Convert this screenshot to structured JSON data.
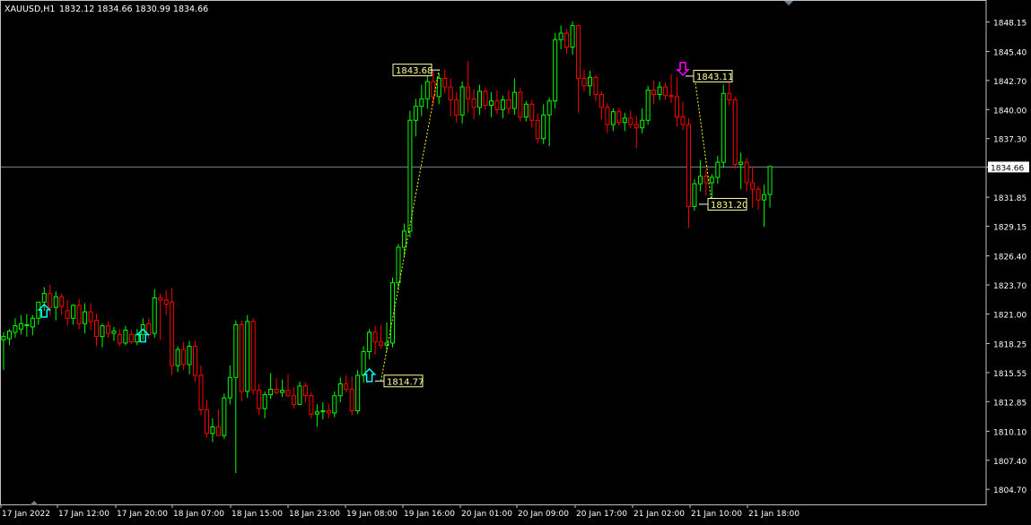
{
  "header": {
    "symbol_timeframe": "XAUUSD,H1",
    "ohlc": "1832.12 1834.66 1830.99 1834.66"
  },
  "colors": {
    "background": "#000000",
    "frame": "#c0c0c0",
    "bull": "#00ff00",
    "bear": "#ff0000",
    "text": "#ffffff",
    "bid_line": "#778899",
    "price_label_bg": "#ffff99",
    "buy_arrow": "#00ffff",
    "sell_arrow": "#ff00ff"
  },
  "chart_data": {
    "type": "candlestick",
    "symbol": "XAUUSD",
    "timeframe": "H1",
    "ylim": [
      1803.3,
      1850.1
    ],
    "y_ticks": [
      "1848.15",
      "1845.40",
      "1842.70",
      "1840.00",
      "1837.30",
      "1834.66",
      "1831.85",
      "1829.15",
      "1826.40",
      "1823.70",
      "1821.00",
      "1818.25",
      "1815.55",
      "1812.85",
      "1810.10",
      "1807.40",
      "1804.70"
    ],
    "x_ticks": [
      "17 Jan 2022",
      "17 Jan 12:00",
      "17 Jan 20:00",
      "18 Jan 07:00",
      "18 Jan 15:00",
      "18 Jan 23:00",
      "19 Jan 08:00",
      "19 Jan 16:00",
      "20 Jan 01:00",
      "20 Jan 09:00",
      "20 Jan 17:00",
      "21 Jan 02:00",
      "21 Jan 10:00",
      "21 Jan 18:00"
    ],
    "current_price": "1834.66",
    "candles": [
      {
        "o": 1818.6,
        "h": 1819.3,
        "l": 1815.8,
        "c": 1818.9
      },
      {
        "o": 1818.7,
        "h": 1819.6,
        "l": 1818.1,
        "c": 1819.4
      },
      {
        "o": 1819.3,
        "h": 1820.6,
        "l": 1818.8,
        "c": 1819.9
      },
      {
        "o": 1819.6,
        "h": 1820.9,
        "l": 1819.1,
        "c": 1820.1
      },
      {
        "o": 1820.0,
        "h": 1821.0,
        "l": 1818.9,
        "c": 1820.0
      },
      {
        "o": 1819.8,
        "h": 1820.9,
        "l": 1819.0,
        "c": 1820.6
      },
      {
        "o": 1820.6,
        "h": 1821.7,
        "l": 1820.0,
        "c": 1822.1
      },
      {
        "o": 1822.1,
        "h": 1823.5,
        "l": 1821.3,
        "c": 1822.9
      },
      {
        "o": 1822.9,
        "h": 1823.7,
        "l": 1820.9,
        "c": 1821.6
      },
      {
        "o": 1821.6,
        "h": 1823.1,
        "l": 1820.4,
        "c": 1822.6
      },
      {
        "o": 1822.6,
        "h": 1822.9,
        "l": 1820.9,
        "c": 1821.7
      },
      {
        "o": 1821.3,
        "h": 1822.3,
        "l": 1819.9,
        "c": 1820.6
      },
      {
        "o": 1820.6,
        "h": 1821.9,
        "l": 1820.0,
        "c": 1821.8
      },
      {
        "o": 1821.8,
        "h": 1822.4,
        "l": 1819.6,
        "c": 1820.1
      },
      {
        "o": 1820.1,
        "h": 1822.0,
        "l": 1819.2,
        "c": 1821.2
      },
      {
        "o": 1821.2,
        "h": 1822.0,
        "l": 1819.5,
        "c": 1820.3
      },
      {
        "o": 1820.4,
        "h": 1821.0,
        "l": 1818.0,
        "c": 1818.9
      },
      {
        "o": 1818.9,
        "h": 1820.1,
        "l": 1817.9,
        "c": 1819.9
      },
      {
        "o": 1819.9,
        "h": 1820.3,
        "l": 1818.8,
        "c": 1819.2
      },
      {
        "o": 1819.2,
        "h": 1819.8,
        "l": 1818.5,
        "c": 1819.4
      },
      {
        "o": 1819.1,
        "h": 1819.6,
        "l": 1818.0,
        "c": 1818.3
      },
      {
        "o": 1818.3,
        "h": 1819.9,
        "l": 1818.1,
        "c": 1819.5
      },
      {
        "o": 1819.1,
        "h": 1819.5,
        "l": 1818.2,
        "c": 1818.4
      },
      {
        "o": 1818.4,
        "h": 1819.6,
        "l": 1818.1,
        "c": 1819.1
      },
      {
        "o": 1819.1,
        "h": 1820.6,
        "l": 1818.6,
        "c": 1820.0
      },
      {
        "o": 1820.1,
        "h": 1820.6,
        "l": 1818.7,
        "c": 1819.1
      },
      {
        "o": 1819.2,
        "h": 1823.3,
        "l": 1818.8,
        "c": 1822.5
      },
      {
        "o": 1822.5,
        "h": 1822.9,
        "l": 1818.6,
        "c": 1822.3
      },
      {
        "o": 1822.3,
        "h": 1823.2,
        "l": 1820.9,
        "c": 1821.9
      },
      {
        "o": 1822.1,
        "h": 1823.4,
        "l": 1815.3,
        "c": 1816.2
      },
      {
        "o": 1816.2,
        "h": 1818.0,
        "l": 1815.6,
        "c": 1817.7
      },
      {
        "o": 1817.7,
        "h": 1818.4,
        "l": 1815.8,
        "c": 1816.3
      },
      {
        "o": 1816.3,
        "h": 1818.5,
        "l": 1815.4,
        "c": 1818.0
      },
      {
        "o": 1818.0,
        "h": 1818.5,
        "l": 1814.7,
        "c": 1815.3
      },
      {
        "o": 1815.3,
        "h": 1816.2,
        "l": 1811.6,
        "c": 1812.1
      },
      {
        "o": 1812.1,
        "h": 1813.0,
        "l": 1809.5,
        "c": 1809.9
      },
      {
        "o": 1809.9,
        "h": 1811.3,
        "l": 1809.1,
        "c": 1810.5
      },
      {
        "o": 1810.5,
        "h": 1812.1,
        "l": 1809.8,
        "c": 1809.7
      },
      {
        "o": 1809.7,
        "h": 1813.6,
        "l": 1809.4,
        "c": 1813.2
      },
      {
        "o": 1813.2,
        "h": 1816.2,
        "l": 1812.6,
        "c": 1815.1
      },
      {
        "o": 1815.1,
        "h": 1820.4,
        "l": 1806.2,
        "c": 1820.0
      },
      {
        "o": 1820.0,
        "h": 1820.4,
        "l": 1812.9,
        "c": 1813.8
      },
      {
        "o": 1813.8,
        "h": 1820.9,
        "l": 1813.2,
        "c": 1820.3
      },
      {
        "o": 1820.3,
        "h": 1820.6,
        "l": 1813.5,
        "c": 1813.9
      },
      {
        "o": 1813.9,
        "h": 1814.5,
        "l": 1811.6,
        "c": 1812.2
      },
      {
        "o": 1812.2,
        "h": 1813.8,
        "l": 1811.3,
        "c": 1813.5
      },
      {
        "o": 1813.5,
        "h": 1815.5,
        "l": 1813.1,
        "c": 1814.0
      },
      {
        "o": 1814.0,
        "h": 1815.0,
        "l": 1813.5,
        "c": 1813.7
      },
      {
        "o": 1813.7,
        "h": 1814.9,
        "l": 1813.3,
        "c": 1813.9
      },
      {
        "o": 1813.9,
        "h": 1815.4,
        "l": 1813.3,
        "c": 1813.4
      },
      {
        "o": 1813.4,
        "h": 1814.2,
        "l": 1812.2,
        "c": 1812.6
      },
      {
        "o": 1812.6,
        "h": 1814.7,
        "l": 1812.5,
        "c": 1814.3
      },
      {
        "o": 1814.3,
        "h": 1814.6,
        "l": 1812.8,
        "c": 1813.4
      },
      {
        "o": 1813.4,
        "h": 1813.7,
        "l": 1811.3,
        "c": 1811.7
      },
      {
        "o": 1811.7,
        "h": 1812.6,
        "l": 1810.5,
        "c": 1811.9
      },
      {
        "o": 1811.9,
        "h": 1812.8,
        "l": 1811.2,
        "c": 1812.0
      },
      {
        "o": 1812.0,
        "h": 1812.6,
        "l": 1811.3,
        "c": 1811.8
      },
      {
        "o": 1811.8,
        "h": 1813.8,
        "l": 1811.4,
        "c": 1813.4
      },
      {
        "o": 1813.4,
        "h": 1815.1,
        "l": 1812.8,
        "c": 1814.5
      },
      {
        "o": 1814.5,
        "h": 1815.3,
        "l": 1813.7,
        "c": 1814.0
      },
      {
        "o": 1814.0,
        "h": 1815.2,
        "l": 1811.6,
        "c": 1812.0
      },
      {
        "o": 1812.0,
        "h": 1815.8,
        "l": 1811.7,
        "c": 1815.3
      },
      {
        "o": 1815.3,
        "h": 1818.0,
        "l": 1814.6,
        "c": 1817.5
      },
      {
        "o": 1817.5,
        "h": 1819.6,
        "l": 1816.8,
        "c": 1819.3
      },
      {
        "o": 1819.3,
        "h": 1819.9,
        "l": 1817.2,
        "c": 1818.4
      },
      {
        "o": 1818.4,
        "h": 1820.0,
        "l": 1817.8,
        "c": 1818.1
      },
      {
        "o": 1818.1,
        "h": 1820.2,
        "l": 1817.5,
        "c": 1818.3
      },
      {
        "o": 1818.3,
        "h": 1824.4,
        "l": 1817.9,
        "c": 1823.9
      },
      {
        "o": 1823.9,
        "h": 1827.5,
        "l": 1823.2,
        "c": 1827.2
      },
      {
        "o": 1827.2,
        "h": 1829.4,
        "l": 1826.3,
        "c": 1828.7
      },
      {
        "o": 1828.7,
        "h": 1839.9,
        "l": 1828.1,
        "c": 1839.0
      },
      {
        "o": 1839.0,
        "h": 1841.0,
        "l": 1837.5,
        "c": 1840.3
      },
      {
        "o": 1840.3,
        "h": 1842.3,
        "l": 1839.4,
        "c": 1841.0
      },
      {
        "o": 1841.0,
        "h": 1843.2,
        "l": 1840.1,
        "c": 1842.6
      },
      {
        "o": 1842.6,
        "h": 1843.6,
        "l": 1840.4,
        "c": 1841.2
      },
      {
        "o": 1841.2,
        "h": 1843.4,
        "l": 1840.5,
        "c": 1842.9
      },
      {
        "o": 1842.9,
        "h": 1843.7,
        "l": 1841.5,
        "c": 1842.1
      },
      {
        "o": 1842.1,
        "h": 1842.9,
        "l": 1839.4,
        "c": 1840.9
      },
      {
        "o": 1840.9,
        "h": 1841.6,
        "l": 1838.8,
        "c": 1839.5
      },
      {
        "o": 1839.5,
        "h": 1842.6,
        "l": 1838.7,
        "c": 1842.1
      },
      {
        "o": 1842.1,
        "h": 1844.5,
        "l": 1839.7,
        "c": 1841.0
      },
      {
        "o": 1841.0,
        "h": 1841.9,
        "l": 1839.1,
        "c": 1840.2
      },
      {
        "o": 1840.2,
        "h": 1842.3,
        "l": 1839.5,
        "c": 1841.7
      },
      {
        "o": 1841.7,
        "h": 1842.0,
        "l": 1840.0,
        "c": 1840.4
      },
      {
        "o": 1840.4,
        "h": 1841.6,
        "l": 1839.3,
        "c": 1840.8
      },
      {
        "o": 1840.8,
        "h": 1841.8,
        "l": 1839.6,
        "c": 1840.0
      },
      {
        "o": 1840.0,
        "h": 1841.3,
        "l": 1839.2,
        "c": 1840.9
      },
      {
        "o": 1840.9,
        "h": 1841.8,
        "l": 1839.6,
        "c": 1840.1
      },
      {
        "o": 1840.1,
        "h": 1842.9,
        "l": 1839.5,
        "c": 1841.6
      },
      {
        "o": 1841.6,
        "h": 1842.0,
        "l": 1838.9,
        "c": 1839.3
      },
      {
        "o": 1839.3,
        "h": 1840.8,
        "l": 1838.9,
        "c": 1840.5
      },
      {
        "o": 1840.5,
        "h": 1840.9,
        "l": 1838.3,
        "c": 1839.0
      },
      {
        "o": 1839.0,
        "h": 1839.6,
        "l": 1836.9,
        "c": 1837.3
      },
      {
        "o": 1837.3,
        "h": 1840.5,
        "l": 1836.8,
        "c": 1839.5
      },
      {
        "o": 1839.5,
        "h": 1841.1,
        "l": 1836.6,
        "c": 1840.8
      },
      {
        "o": 1840.8,
        "h": 1847.1,
        "l": 1840.1,
        "c": 1846.5
      },
      {
        "o": 1846.5,
        "h": 1847.8,
        "l": 1845.6,
        "c": 1847.1
      },
      {
        "o": 1847.1,
        "h": 1847.5,
        "l": 1845.2,
        "c": 1845.8
      },
      {
        "o": 1845.8,
        "h": 1848.2,
        "l": 1845.1,
        "c": 1847.8
      },
      {
        "o": 1847.8,
        "h": 1847.9,
        "l": 1839.7,
        "c": 1842.9
      },
      {
        "o": 1842.9,
        "h": 1843.7,
        "l": 1841.7,
        "c": 1842.2
      },
      {
        "o": 1842.2,
        "h": 1843.6,
        "l": 1841.3,
        "c": 1843.0
      },
      {
        "o": 1843.0,
        "h": 1843.2,
        "l": 1840.8,
        "c": 1841.4
      },
      {
        "o": 1841.4,
        "h": 1841.7,
        "l": 1839.1,
        "c": 1840.2
      },
      {
        "o": 1840.2,
        "h": 1840.6,
        "l": 1837.8,
        "c": 1838.6
      },
      {
        "o": 1838.6,
        "h": 1840.1,
        "l": 1838.0,
        "c": 1839.8
      },
      {
        "o": 1839.8,
        "h": 1840.2,
        "l": 1838.5,
        "c": 1838.8
      },
      {
        "o": 1838.8,
        "h": 1839.7,
        "l": 1838.0,
        "c": 1839.2
      },
      {
        "o": 1839.2,
        "h": 1839.9,
        "l": 1838.3,
        "c": 1838.6
      },
      {
        "o": 1838.6,
        "h": 1839.4,
        "l": 1836.4,
        "c": 1838.3
      },
      {
        "o": 1838.3,
        "h": 1840.1,
        "l": 1837.8,
        "c": 1839.0
      },
      {
        "o": 1839.0,
        "h": 1842.2,
        "l": 1838.6,
        "c": 1841.8
      },
      {
        "o": 1841.8,
        "h": 1842.7,
        "l": 1840.5,
        "c": 1841.4
      },
      {
        "o": 1841.4,
        "h": 1842.6,
        "l": 1840.9,
        "c": 1842.1
      },
      {
        "o": 1842.1,
        "h": 1842.5,
        "l": 1840.9,
        "c": 1841.3
      },
      {
        "o": 1841.3,
        "h": 1843.3,
        "l": 1840.6,
        "c": 1841.2
      },
      {
        "o": 1841.2,
        "h": 1843.0,
        "l": 1838.4,
        "c": 1839.3
      },
      {
        "o": 1839.3,
        "h": 1840.7,
        "l": 1838.1,
        "c": 1838.6
      },
      {
        "o": 1838.6,
        "h": 1839.2,
        "l": 1829.0,
        "c": 1831.0
      },
      {
        "o": 1831.0,
        "h": 1833.5,
        "l": 1830.6,
        "c": 1833.1
      },
      {
        "o": 1833.1,
        "h": 1835.3,
        "l": 1832.4,
        "c": 1833.8
      },
      {
        "o": 1833.8,
        "h": 1834.4,
        "l": 1832.0,
        "c": 1833.2
      },
      {
        "o": 1833.2,
        "h": 1834.0,
        "l": 1831.3,
        "c": 1833.7
      },
      {
        "o": 1833.7,
        "h": 1835.7,
        "l": 1833.1,
        "c": 1835.1
      },
      {
        "o": 1835.1,
        "h": 1842.3,
        "l": 1834.6,
        "c": 1841.5
      },
      {
        "o": 1841.5,
        "h": 1842.8,
        "l": 1840.4,
        "c": 1840.9
      },
      {
        "o": 1840.9,
        "h": 1841.2,
        "l": 1834.5,
        "c": 1834.9
      },
      {
        "o": 1834.9,
        "h": 1836.0,
        "l": 1832.6,
        "c": 1835.1
      },
      {
        "o": 1835.1,
        "h": 1835.5,
        "l": 1832.4,
        "c": 1833.2
      },
      {
        "o": 1833.2,
        "h": 1834.7,
        "l": 1830.9,
        "c": 1832.6
      },
      {
        "o": 1832.6,
        "h": 1832.9,
        "l": 1830.7,
        "c": 1831.6
      },
      {
        "o": 1831.6,
        "h": 1833.0,
        "l": 1829.1,
        "c": 1832.1
      },
      {
        "o": 1832.1,
        "h": 1834.8,
        "l": 1830.9,
        "c": 1834.7
      }
    ],
    "price_labels": [
      {
        "text": "1843.68",
        "price": 1843.68
      },
      {
        "text": "1814.77",
        "price": 1814.77
      },
      {
        "text": "1843.11",
        "price": 1843.11
      },
      {
        "text": "1831.20",
        "price": 1831.2
      }
    ],
    "signals": [
      {
        "type": "buy",
        "price": 1821.3
      },
      {
        "type": "buy",
        "price": 1819.0
      },
      {
        "type": "buy",
        "price": 1815.3
      },
      {
        "type": "sell",
        "price": 1843.7
      }
    ],
    "trend_lines": [
      {
        "from_price": 1814.77,
        "to_price": 1843.68
      },
      {
        "from_price": 1843.11,
        "to_price": 1831.2
      }
    ]
  }
}
